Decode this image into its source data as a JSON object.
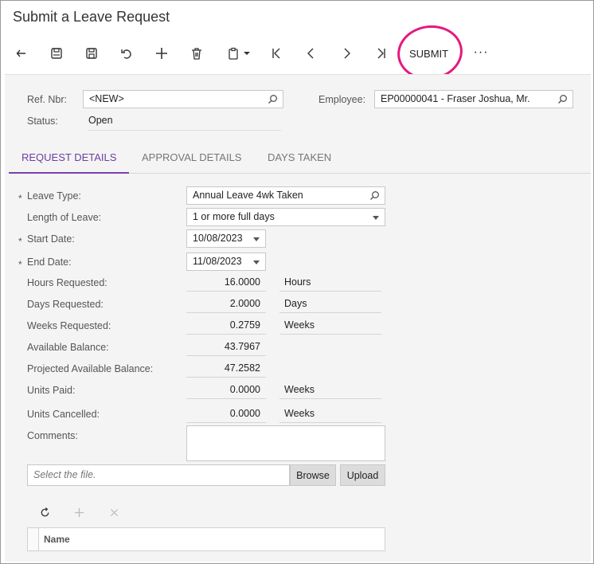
{
  "title": "Submit a Leave Request",
  "toolbar": {
    "submit_label": "SUBMIT",
    "more_label": "···",
    "icons": [
      "back-icon",
      "save-close-icon",
      "save-icon",
      "undo-icon",
      "add-icon",
      "delete-icon",
      "clipboard-icon",
      "first-icon",
      "prev-icon",
      "next-icon",
      "last-icon"
    ]
  },
  "header": {
    "ref_nbr_label": "Ref. Nbr:",
    "ref_nbr_value": "<NEW>",
    "status_label": "Status:",
    "status_value": "Open",
    "employee_label": "Employee:",
    "employee_value": "EP00000041 - Fraser Joshua, Mr."
  },
  "tabs": [
    "REQUEST DETAILS",
    "APPROVAL DETAILS",
    "DAYS TAKEN"
  ],
  "form": {
    "leave_type_label": "Leave Type:",
    "leave_type_value": "Annual Leave 4wk Taken",
    "length_label": "Length of Leave:",
    "length_value": "1 or more full days",
    "start_label": "Start Date:",
    "start_value": "10/08/2023",
    "end_label": "End Date:",
    "end_value": "11/08/2023",
    "hours_label": "Hours Requested:",
    "hours_value": "16.0000",
    "hours_unit": "Hours",
    "days_label": "Days Requested:",
    "days_value": "2.0000",
    "days_unit": "Days",
    "weeks_label": "Weeks Requested:",
    "weeks_value": "0.2759",
    "weeks_unit": "Weeks",
    "avail_label": "Available Balance:",
    "avail_value": "43.7967",
    "proj_label": "Projected Available Balance:",
    "proj_value": "47.2582",
    "paid_label": "Units Paid:",
    "paid_value": "0.0000",
    "paid_unit": "Weeks",
    "cancel_label": "Units Cancelled:",
    "cancel_value": "0.0000",
    "cancel_unit": "Weeks",
    "comments_label": "Comments:",
    "comments_value": "",
    "required_mark": "*"
  },
  "file": {
    "placeholder": "Select the file.",
    "browse_label": "Browse",
    "upload_label": "Upload"
  },
  "grid": {
    "column_name": "Name"
  },
  "colors": {
    "accent": "#7a3fb0",
    "annotation": "#e5197e"
  }
}
